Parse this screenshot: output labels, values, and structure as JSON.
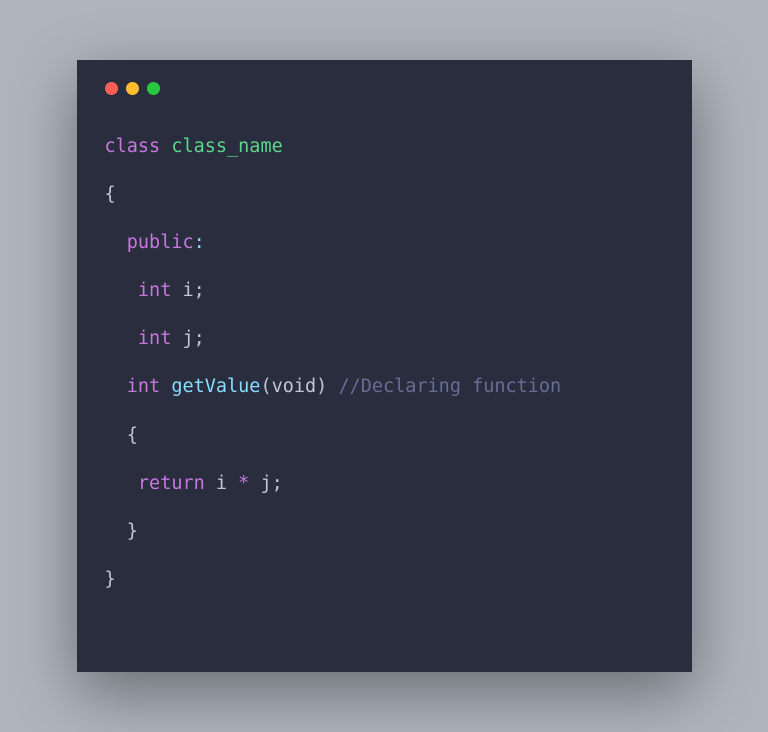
{
  "code": {
    "line1": {
      "keyword": "class",
      "classname": "class_name"
    },
    "line2": {
      "brace": "{"
    },
    "line3": {
      "access": "public",
      "colon": ":"
    },
    "line4": {
      "type": "int",
      "ident": "i",
      "semi": ";"
    },
    "line5": {
      "type": "int",
      "ident": "j",
      "semi": ";"
    },
    "line6": {
      "type": "int",
      "func": "getValue",
      "lparen": "(",
      "void": "void",
      "rparen": ")",
      "comment": "//Declaring function"
    },
    "line7": {
      "brace": "{"
    },
    "line8": {
      "return": "return",
      "ident1": "i",
      "op": "*",
      "ident2": "j",
      "semi": ";"
    },
    "line9": {
      "brace": "}"
    },
    "line10": {
      "brace": "}"
    }
  }
}
